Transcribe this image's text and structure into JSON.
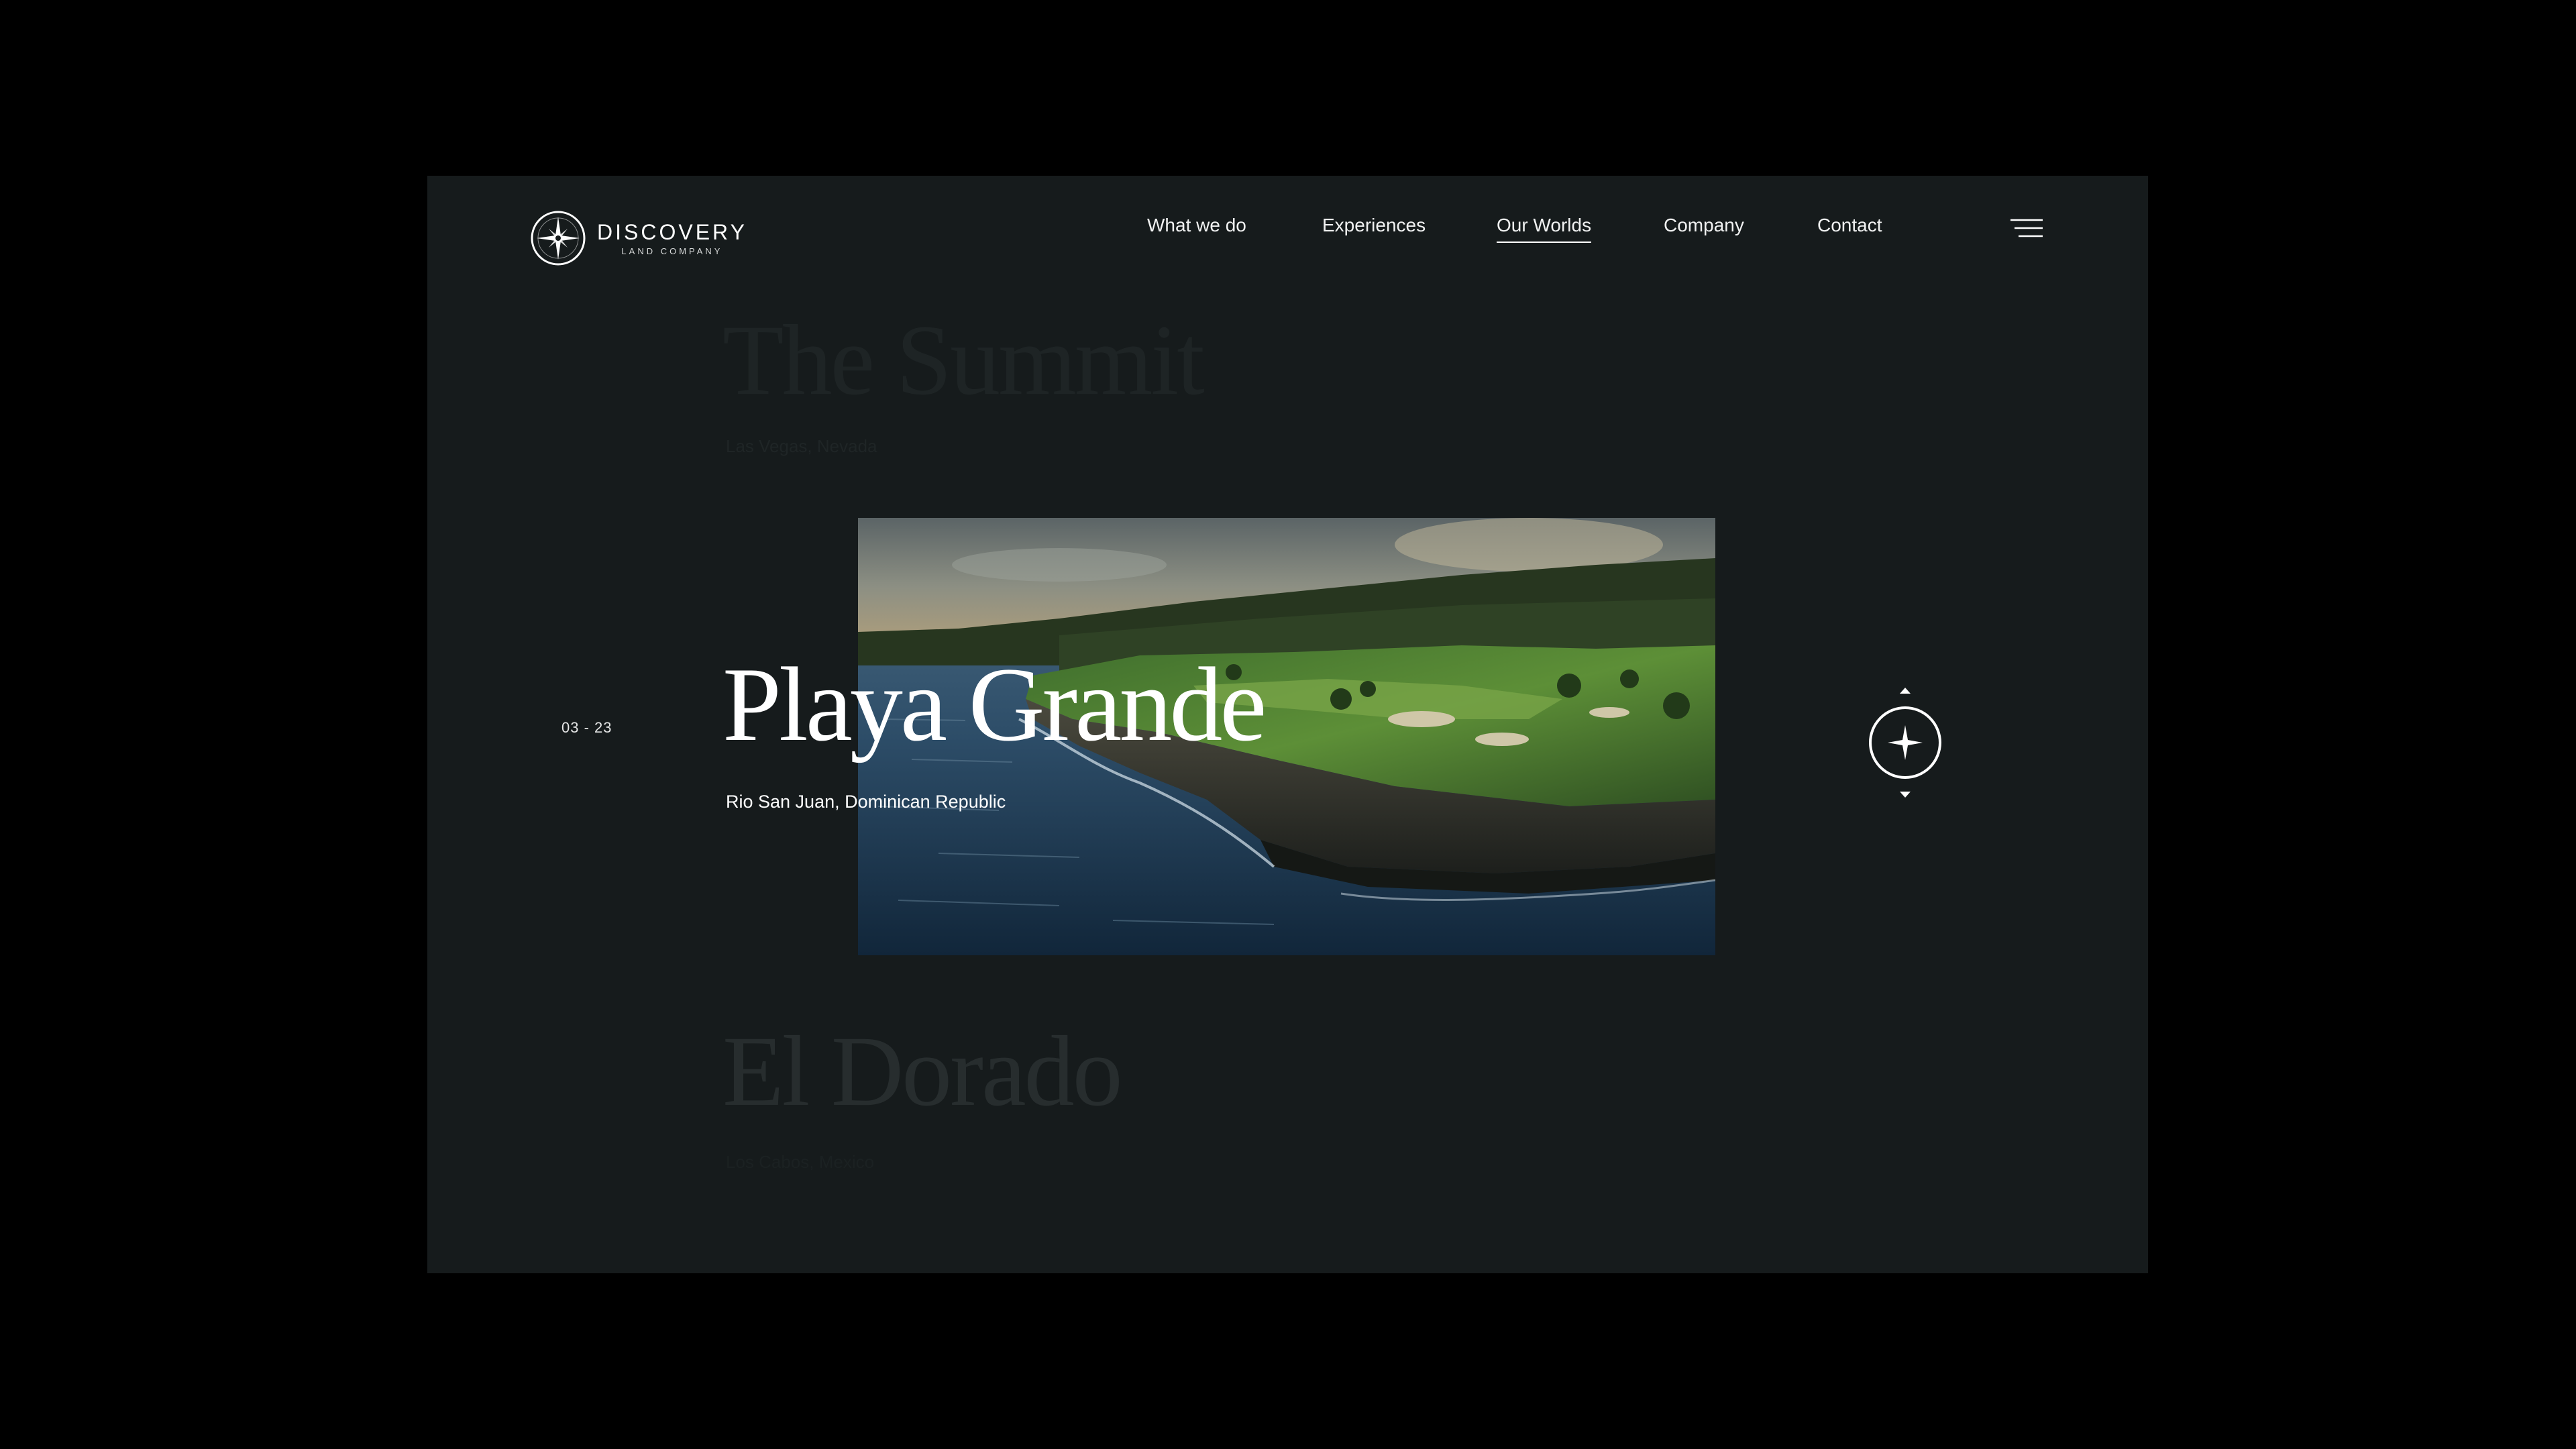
{
  "brand": {
    "name": "DISCOVERY",
    "subtitle": "LAND COMPANY"
  },
  "nav": {
    "items": [
      {
        "label": "What we do",
        "active": false
      },
      {
        "label": "Experiences",
        "active": false
      },
      {
        "label": "Our Worlds",
        "active": true
      },
      {
        "label": "Company",
        "active": false
      },
      {
        "label": "Contact",
        "active": false
      }
    ]
  },
  "counter": "03 - 23",
  "worlds": {
    "previous": {
      "title": "The Summit",
      "location": "Las Vegas, Nevada"
    },
    "current": {
      "title": "Playa Grande",
      "location": "Rio San Juan, Dominican Republic"
    },
    "next": {
      "title": "El Dorado",
      "location": "Los Cabos, Mexico"
    }
  },
  "icons": {
    "logo": "compass-star-icon",
    "menu": "hamburger-menu-icon",
    "scroll_control": "compass-scroll-icon",
    "scroll_up": "caret-up-icon",
    "scroll_down": "caret-down-icon"
  },
  "colors": {
    "background": "#000000",
    "panel": "#161b1c",
    "text": "#ffffff",
    "faded_text": "#2a3031"
  }
}
